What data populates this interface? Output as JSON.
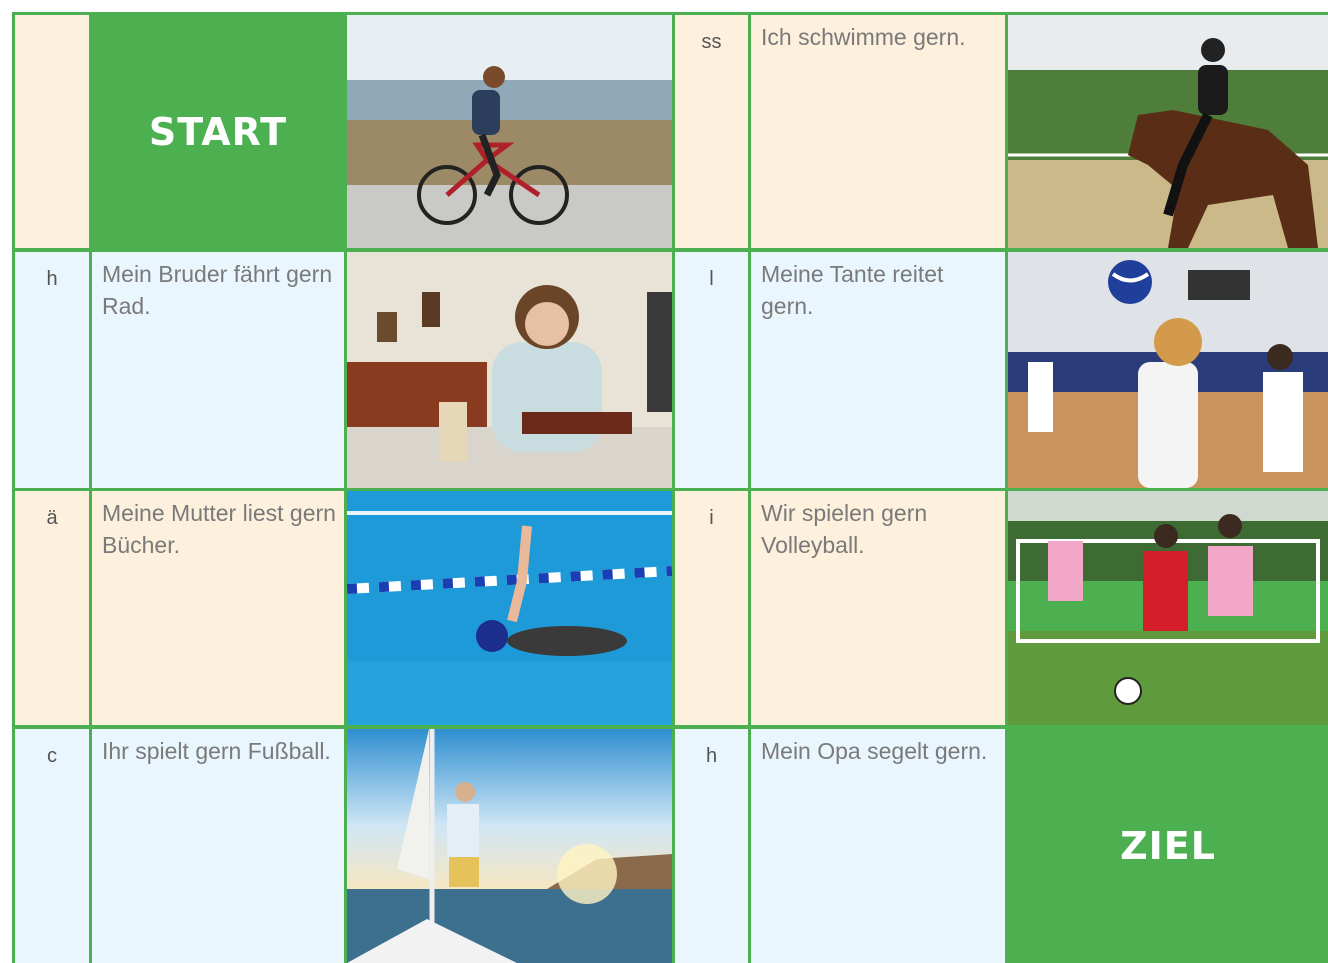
{
  "board": {
    "start_label": "START",
    "goal_label": "ZIEL",
    "rows": [
      {
        "left_letter": "",
        "left_sentence": "",
        "right_letter": "ss",
        "right_sentence": "Ich schwimme gern.",
        "left_photo": "cycling-photo",
        "right_photo": "horse-riding-photo"
      },
      {
        "left_letter": "h",
        "left_sentence": "Mein Bruder fährt gern Rad.",
        "right_letter": "l",
        "right_sentence": "Meine Tante reitet gern.",
        "left_photo": "reading-photo",
        "right_photo": "volleyball-photo"
      },
      {
        "left_letter": "ä",
        "left_sentence": "Meine Mutter liest gern Bücher.",
        "right_letter": "i",
        "right_sentence": "Wir spielen gern Volleyball.",
        "left_photo": "swimming-photo",
        "right_photo": "football-photo"
      },
      {
        "left_letter": "c",
        "left_sentence": "Ihr spielt gern Fußball.",
        "right_letter": "h",
        "right_sentence": "Mein Opa segelt gern.",
        "left_photo": "sailing-photo",
        "right_photo": ""
      }
    ]
  },
  "colors": {
    "green": "#4caf50",
    "cream": "#fdf0dc",
    "light_blue": "#eaf6fd"
  }
}
